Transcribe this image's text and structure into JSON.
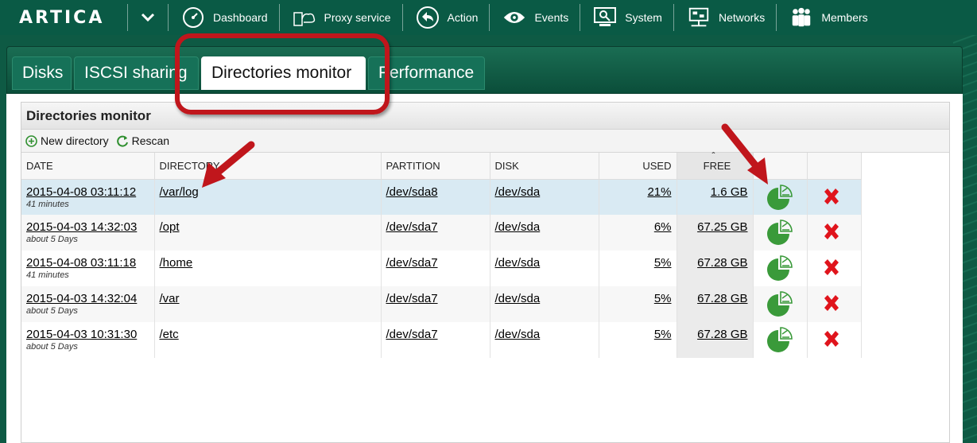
{
  "app": {
    "logo": "ARTICA"
  },
  "nav": [
    {
      "label": "Dashboard",
      "icon": "dashboard-icon"
    },
    {
      "label": "Proxy service",
      "icon": "proxy-service-icon"
    },
    {
      "label": "Action",
      "icon": "action-icon"
    },
    {
      "label": "Events",
      "icon": "events-eye-icon"
    },
    {
      "label": "System",
      "icon": "system-icon"
    },
    {
      "label": "Networks",
      "icon": "networks-icon"
    },
    {
      "label": "Members",
      "icon": "members-icon"
    }
  ],
  "tabs": [
    {
      "label": "Disks"
    },
    {
      "label": "ISCSI sharing"
    },
    {
      "label": "Directories monitor",
      "active": true
    },
    {
      "label": "Performance"
    }
  ],
  "panel": {
    "title": "Directories monitor",
    "toolbar": {
      "new_directory": "New directory",
      "rescan": "Rescan"
    }
  },
  "table": {
    "columns": [
      "DATE",
      "DIRECTORY",
      "PARTITION",
      "DISK",
      "USED",
      "FREE"
    ],
    "sort_indicator": "ˆ",
    "rows": [
      {
        "date": "2015-04-08 03:11:12",
        "ago": "41 minutes",
        "directory": "/var/log",
        "partition": "/dev/sda8",
        "disk": "/dev/sda",
        "used": "21%",
        "free": "1.6 GB"
      },
      {
        "date": "2015-04-03 14:32:03",
        "ago": "about 5 Days",
        "directory": "/opt",
        "partition": "/dev/sda7",
        "disk": "/dev/sda",
        "used": "6%",
        "free": "67.25 GB"
      },
      {
        "date": "2015-04-08 03:11:18",
        "ago": "41 minutes",
        "directory": "/home",
        "partition": "/dev/sda7",
        "disk": "/dev/sda",
        "used": "5%",
        "free": "67.28 GB"
      },
      {
        "date": "2015-04-03 14:32:04",
        "ago": "about 5 Days",
        "directory": "/var",
        "partition": "/dev/sda7",
        "disk": "/dev/sda",
        "used": "5%",
        "free": "67.28 GB"
      },
      {
        "date": "2015-04-03 10:31:30",
        "ago": "about 5 Days",
        "directory": "/etc",
        "partition": "/dev/sda7",
        "disk": "/dev/sda",
        "used": "5%",
        "free": "67.28 GB"
      }
    ]
  },
  "colors": {
    "brand_green": "#0a5a45",
    "annotation_red": "#c0161c",
    "delete_red": "#e0141c",
    "chart_green": "#3a9a3a"
  }
}
